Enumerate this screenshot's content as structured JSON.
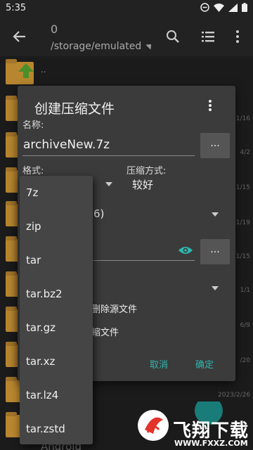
{
  "status_bar": {
    "time": "5:35",
    "icons": [
      "do-not-disturb-icon",
      "wifi-icon",
      "signal-icon",
      "battery-icon"
    ]
  },
  "app_bar": {
    "count": "0",
    "path": "/storage/emulated",
    "icons": [
      "back-arrow-icon",
      "search-icon",
      "list-view-icon",
      "more-vert-icon"
    ]
  },
  "background_list": {
    "parent_label": "..",
    "dates": [
      "1/16",
      "4/2",
      "1/15",
      "1/19",
      "1/15",
      "1/1",
      "6/9",
      "/20"
    ],
    "bottom_date": "2023/2/26",
    "last_folder": "Android"
  },
  "dialog": {
    "title": "创建压缩文件",
    "name_label": "名称:",
    "name_value": "archiveNew.7z",
    "browse_button": "...",
    "format_label": "格式:",
    "compression_label": "压缩方式:",
    "compression_value": "较好",
    "partial_value_1": "6)",
    "password_browse_button": "...",
    "partial_option_1": "删除源文件",
    "partial_option_2": "缩文件",
    "cancel": "取消",
    "ok": "确定"
  },
  "format_dropdown": {
    "options": [
      "7z",
      "zip",
      "tar",
      "tar.bz2",
      "tar.gz",
      "tar.xz",
      "tar.lz4",
      "tar.zstd"
    ]
  },
  "watermark": {
    "text": "飞翔下载",
    "url": "WWW.FXXZ.COM"
  },
  "colors": {
    "accent": "#2fb7b0",
    "dialog_bg": "#3b3b3b",
    "popup_bg": "#454545",
    "folder": "#b8862f"
  }
}
